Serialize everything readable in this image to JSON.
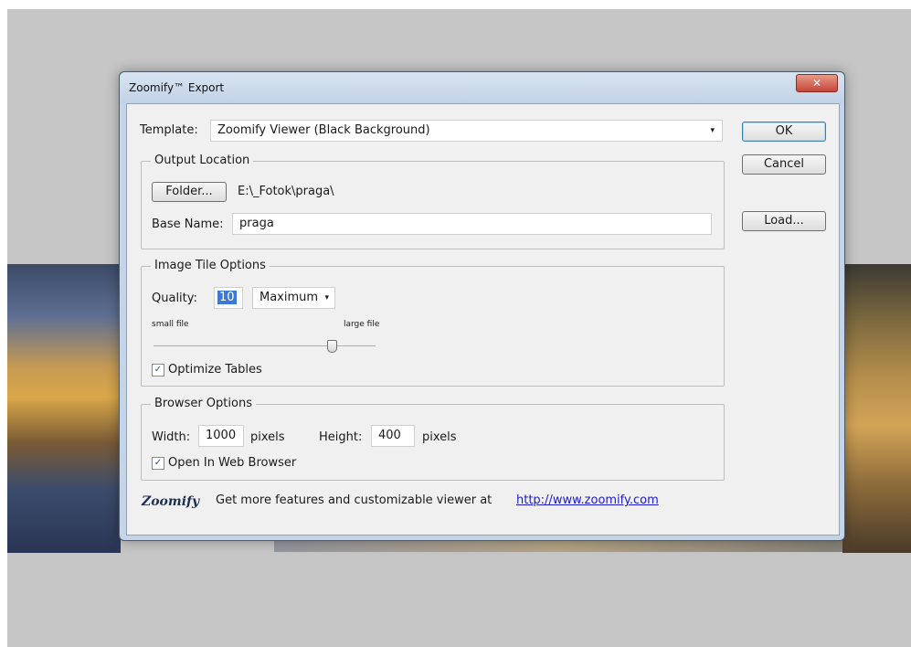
{
  "dialog": {
    "title": "Zoomify™ Export",
    "close_glyph": "✕"
  },
  "template": {
    "label": "Template:",
    "value": "Zoomify Viewer (Black Background)",
    "caret": "▾"
  },
  "buttons": {
    "ok": "OK",
    "cancel": "Cancel",
    "load": "Load..."
  },
  "output_location": {
    "legend": "Output Location",
    "folder_button": "Folder...",
    "folder_path": "E:\\_Fotok\\praga\\",
    "base_name_label": "Base Name:",
    "base_name_value": "praga"
  },
  "image_tile_options": {
    "legend": "Image Tile Options",
    "quality_label": "Quality:",
    "quality_value": "10",
    "quality_preset": "Maximum",
    "quality_caret": "▾",
    "small_file_label": "small file",
    "large_file_label": "large file",
    "slider_level_fraction": 0.83,
    "optimize_tables_label": "Optimize Tables",
    "optimize_tables_checked": true
  },
  "browser_options": {
    "legend": "Browser Options",
    "width_label": "Width:",
    "width_value": "1000",
    "width_unit": "pixels",
    "height_label": "Height:",
    "height_value": "400",
    "height_unit": "pixels",
    "open_in_browser_label": "Open In Web Browser",
    "open_in_browser_checked": true
  },
  "footer": {
    "brand": "Zoomify",
    "text": "Get more features and customizable viewer at",
    "link": "http://www.zoomify.com"
  },
  "check_glyph": "✓"
}
